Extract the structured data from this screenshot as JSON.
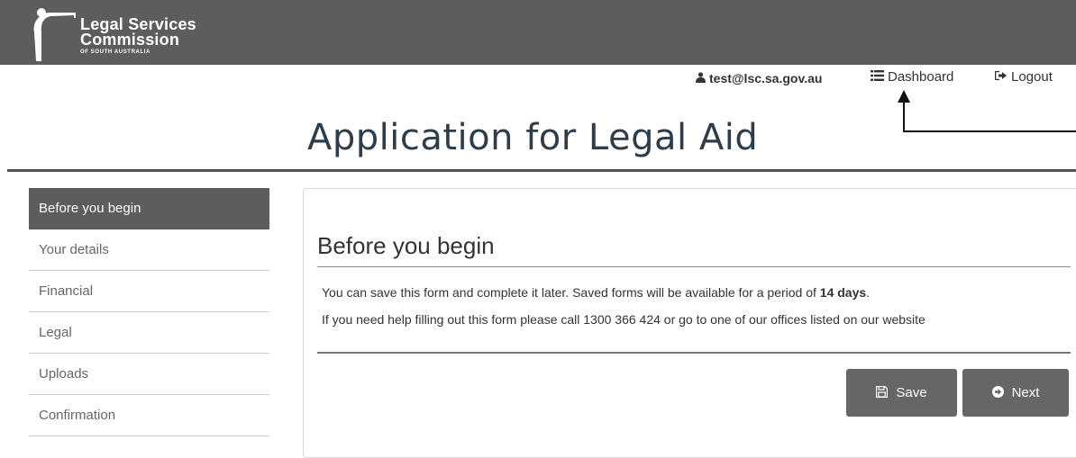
{
  "header": {
    "logo_line1": "Legal Services",
    "logo_line2": "Commission",
    "logo_line3": "OF SOUTH AUSTRALIA",
    "user_email": "test@lsc.sa.gov.au",
    "dashboard_label": "Dashboard",
    "logout_label": "Logout"
  },
  "page": {
    "title": "Application for Legal Aid"
  },
  "sidebar": {
    "items": [
      {
        "label": "Before you begin",
        "active": true
      },
      {
        "label": "Your details"
      },
      {
        "label": "Financial"
      },
      {
        "label": "Legal"
      },
      {
        "label": "Uploads"
      },
      {
        "label": "Confirmation"
      }
    ]
  },
  "main": {
    "heading": "Before you begin",
    "para1_prefix": "You can save this form and complete it later. Saved forms will be available for a period of ",
    "para1_bold": "14 days",
    "para1_suffix": ".",
    "para2": "If you need help filling out this form please call 1300 366 424 or go to one of our offices listed on our website",
    "save_label": "Save",
    "next_label": "Next"
  },
  "colors": {
    "header_bg": "#5d5d5d",
    "active_item_bg": "#5d5d5d",
    "button_bg": "#666666",
    "title_color": "#2e3d49"
  },
  "icons": {
    "user": "user-icon",
    "dashboard": "list-icon",
    "logout": "sign-out-icon",
    "save": "floppy-disk-icon",
    "next": "arrow-circle-right-icon"
  }
}
